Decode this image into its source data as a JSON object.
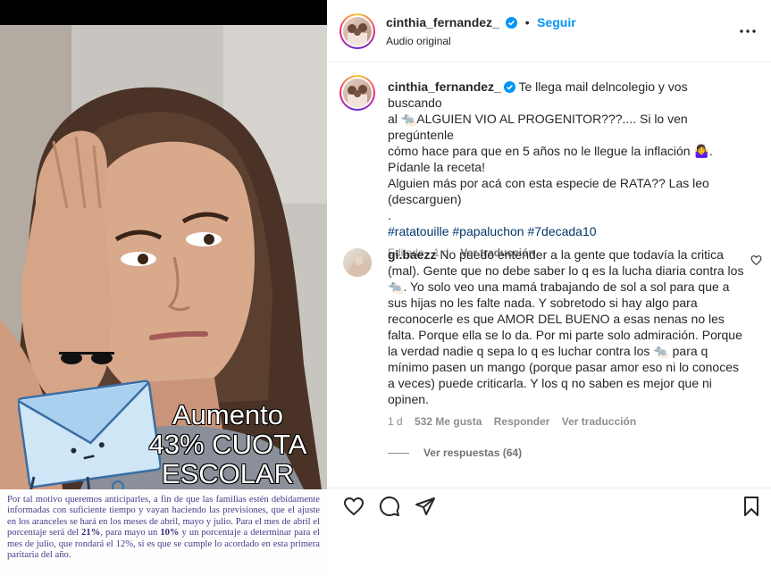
{
  "post": {
    "author": "cinthia_fernandez_",
    "verified": true,
    "follow_label": "Seguir",
    "audio_label": "Audio original",
    "more_icon": "more-horizontal-icon"
  },
  "media": {
    "overlay_lines": [
      "Aumento",
      "43% CUOTA",
      "ESCOLAR"
    ],
    "notice_text_1": "Por tal motivo queremos anticiparles, a fin de que las familias estén debidamente informadas con suficiente tiempo y vayan haciendo las previsiones, que el ajuste en los aranceles se hará en los meses de abril, mayo y julio. Para el mes de abril el porcentaje será del ",
    "notice_bold_1": "21%",
    "notice_text_2": ", para mayo un ",
    "notice_bold_2": "10%",
    "notice_text_3": " y un porcentaje a determinar para el mes de julio, que rondará el 12%, si es que se cumple lo acordado en esta primera paritaria del año."
  },
  "caption": {
    "author": "cinthia_fernandez_",
    "line1_a": "Te llega mail delncolegio y vos buscando",
    "line2_a": "al ",
    "line2_b": "ALGUIEN VIO AL PROGENITOR???.... Si lo ven pregúntenle",
    "line3_a": "cómo hace para que en 5 años no le llegue la inflación ",
    "line3_b": ".",
    "line4": "Pídanle la receta!",
    "line5": "Alguien más por acá con esta especie de RATA?? Las leo",
    "line6": "(descarguen)",
    "line7": ".",
    "hashtags": "#ratatouille #papaluchon #7decada10",
    "edited": "Editado",
    "time": "1 d",
    "translate": "Ver traducción"
  },
  "comment": {
    "author": "gi.baezz",
    "text_1": "No puedo entender a la gente que todavía la critica (mal). Gente que no debe saber lo q es la lucha diaria contra los ",
    "text_2": ". Yo solo veo una mamá trabajando de sol a sol para que a sus hijas no les falte nada. Y sobretodo si hay algo para reconocerle es que AMOR DEL BUENO a esas nenas no les falta. Porque ella se lo da. Por mi parte solo admiración. Porque la verdad nadie q sepa lo q es luchar contra los ",
    "text_3": " para q mínimo pasen un mango (porque pasar amor eso ni lo conoces a veces) puede criticarla. Y los q no saben es mejor que ni opinen.",
    "time": "1 d",
    "likes": "532 Me gusta",
    "reply": "Responder",
    "translate": "Ver traducción",
    "view_replies": "Ver respuestas (64)"
  },
  "colors": {
    "link": "#0095f6",
    "hashtag": "#00376b",
    "muted": "#8e8e8e",
    "notice_text": "#4a3a8c"
  },
  "icons": [
    "heart-icon",
    "comment-icon",
    "share-icon",
    "bookmark-icon",
    "rat-emoji",
    "woman-shrugging-emoji",
    "envelope-sticker",
    "sunglasses-sticker"
  ]
}
